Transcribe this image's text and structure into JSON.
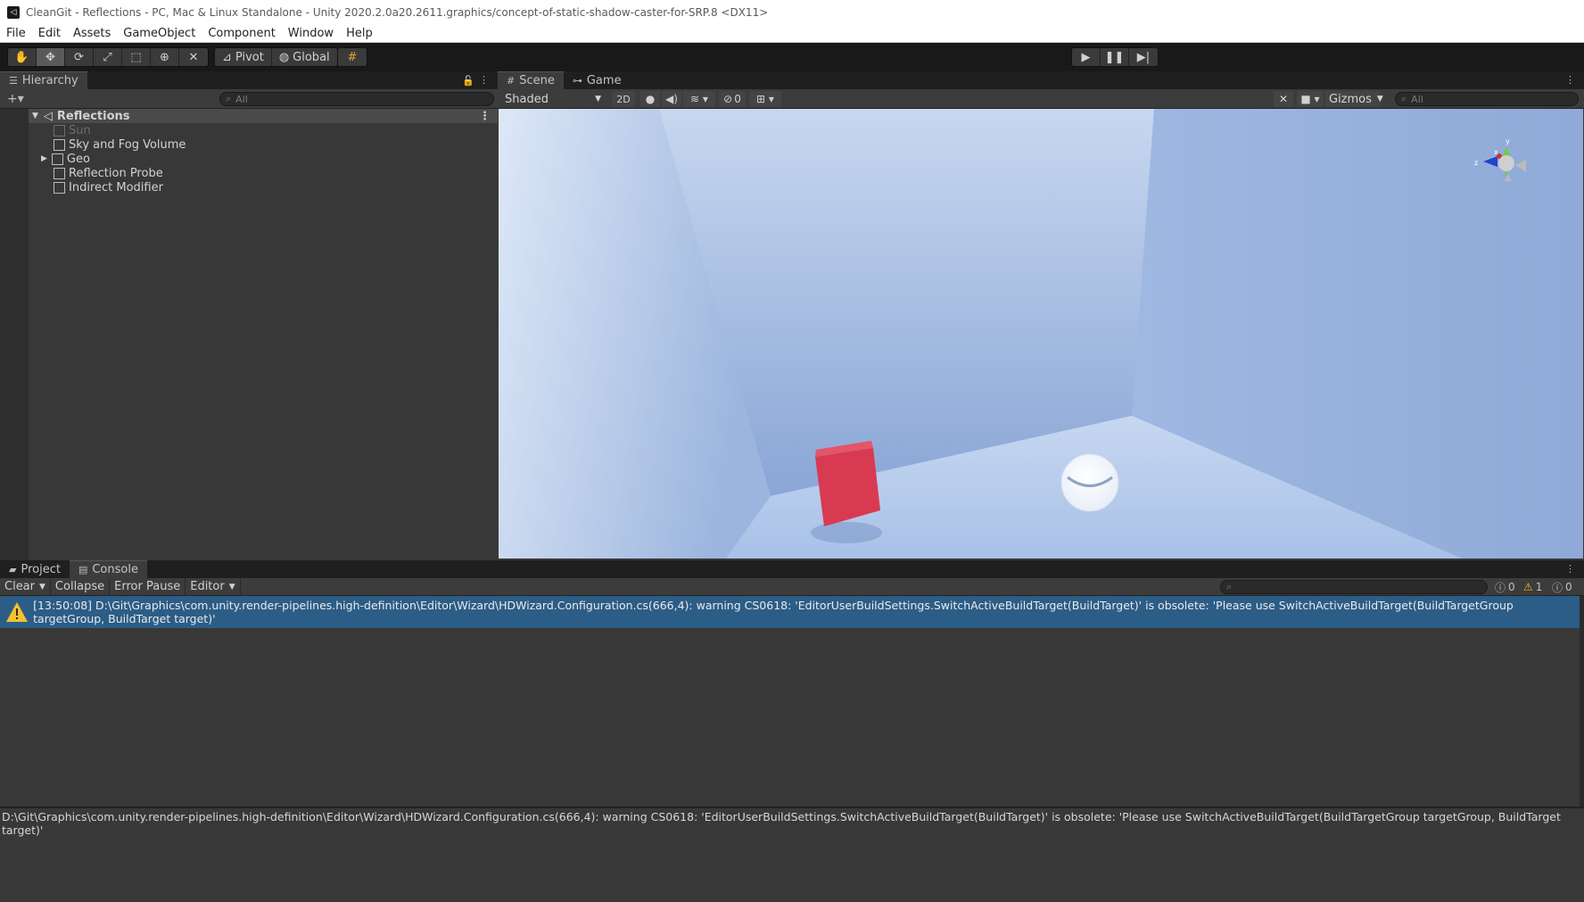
{
  "window": {
    "title": "CleanGit - Reflections - PC, Mac & Linux Standalone - Unity 2020.2.0a20.2611.graphics/concept-of-static-shadow-caster-for-SRP.8 <DX11>"
  },
  "menu": [
    "File",
    "Edit",
    "Assets",
    "GameObject",
    "Component",
    "Window",
    "Help"
  ],
  "toolbar": {
    "pivot_label": "Pivot",
    "global_label": "Global"
  },
  "hierarchy": {
    "tab_label": "Hierarchy",
    "search_placeholder": "All",
    "root": "Reflections",
    "items": [
      "Sun",
      "Sky and Fog Volume",
      "Geo",
      "Reflection Probe",
      "Indirect Modifier"
    ]
  },
  "scene": {
    "tabs": [
      "Scene",
      "Game"
    ],
    "shading_mode": "Shaded",
    "mode_2d": "2D",
    "hidden_count": "0",
    "gizmos_label": "Gizmos",
    "search_placeholder": "All",
    "gizmo_axes": [
      "y",
      "x",
      "z"
    ]
  },
  "console": {
    "tabs": [
      "Project",
      "Console"
    ],
    "clear_label": "Clear",
    "collapse_label": "Collapse",
    "error_pause_label": "Error Pause",
    "editor_label": "Editor",
    "info_count": "0",
    "warning_count": "1",
    "error_count": "0",
    "log_entry": "[13:50:08] D:\\Git\\Graphics\\com.unity.render-pipelines.high-definition\\Editor\\Wizard\\HDWizard.Configuration.cs(666,4): warning CS0618: 'EditorUserBuildSettings.SwitchActiveBuildTarget(BuildTarget)' is obsolete: 'Please use SwitchActiveBuildTarget(BuildTargetGroup targetGroup, BuildTarget target)'",
    "detail": "D:\\Git\\Graphics\\com.unity.render-pipelines.high-definition\\Editor\\Wizard\\HDWizard.Configuration.cs(666,4): warning CS0618: 'EditorUserBuildSettings.SwitchActiveBuildTarget(BuildTarget)' is obsolete: 'Please use SwitchActiveBuildTarget(BuildTargetGroup targetGroup, BuildTarget target)'"
  },
  "colors": {
    "accent_selection": "#2c5d87",
    "cube": "#d83a52",
    "warning": "#f2c232"
  }
}
